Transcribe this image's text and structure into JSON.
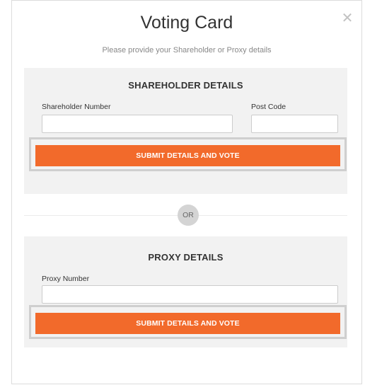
{
  "modal": {
    "title": "Voting Card",
    "subtitle": "Please provide your Shareholder or Proxy details",
    "close_icon": "close-icon"
  },
  "shareholder": {
    "heading": "SHAREHOLDER DETAILS",
    "number_label": "Shareholder Number",
    "number_value": "",
    "postcode_label": "Post Code",
    "postcode_value": "",
    "submit_label": "SUBMIT DETAILS AND VOTE"
  },
  "divider": {
    "label": "OR"
  },
  "proxy": {
    "heading": "PROXY DETAILS",
    "number_label": "Proxy Number",
    "number_value": "",
    "submit_label": "SUBMIT DETAILS AND VOTE"
  },
  "colors": {
    "accent": "#f26a2b",
    "panel_background": "#f2f2f2",
    "button_outline": "#cfcfcf",
    "divider_badge": "#d4d4d4"
  }
}
